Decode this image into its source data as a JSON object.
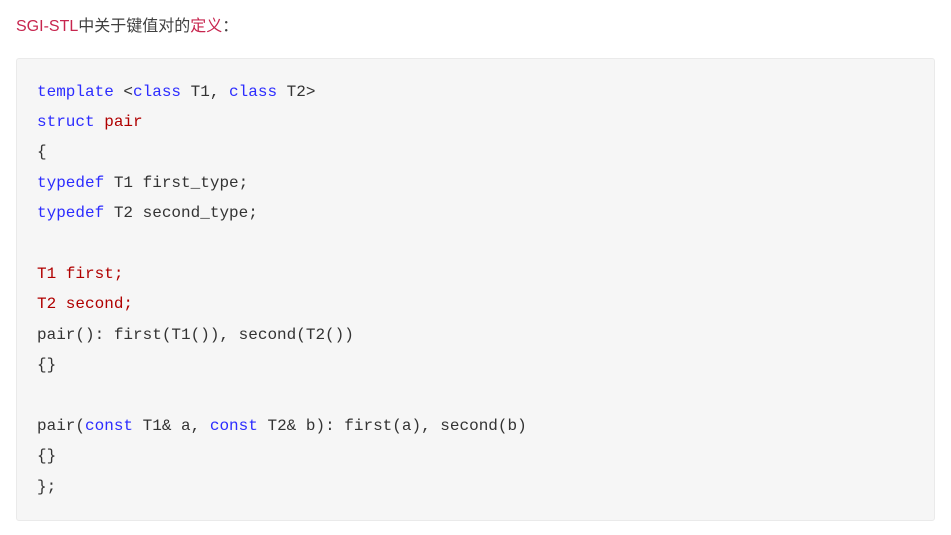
{
  "heading": {
    "part1": "SGI-STL",
    "part2": "中关于键值对的",
    "part3": "定义",
    "part4": "："
  },
  "code": {
    "l1_template": "template",
    "l1_open": " <",
    "l1_class1": "class",
    "l1_t1": " T1",
    "l1_comma": ", ",
    "l1_class2": "class",
    "l1_t2": " T2",
    "l1_close": ">",
    "l2_struct": "struct",
    "l2_space": " ",
    "l2_pair": "pair",
    "l3_brace": "{",
    "l4_typedef": "typedef",
    "l4_rest": " T1 first_type;",
    "l5_typedef": "typedef",
    "l5_rest": " T2 second_type;",
    "l6_empty": "",
    "l7_t1first": "T1 first;",
    "l8_t2second": "T2 second;",
    "l9_pair": "pair",
    "l9_rest": "(): first(T1()), second(T2())",
    "l10_braces": "{}",
    "l11_empty": "",
    "l12_pair": "pair",
    "l12_open": "(",
    "l12_const1": "const",
    "l12_arg1": " T1& a, ",
    "l12_const2": "const",
    "l12_arg2": " T2& b): first(a), second(b)",
    "l13_braces": "{}",
    "l14_close": "};"
  }
}
